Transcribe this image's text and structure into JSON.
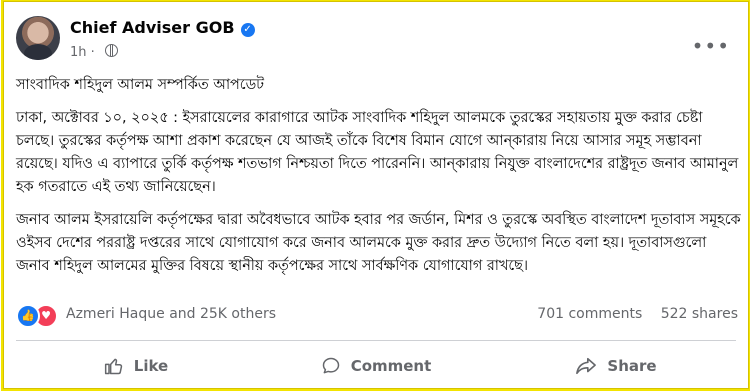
{
  "post": {
    "author": "Chief Adviser GOB",
    "time": "1h",
    "separator": "·",
    "title": "সাংবাদিক শহিদুল আলম সম্পর্কিত আপডেট",
    "paragraph1": "ঢাকা, অক্টোবর ১০, ২০২৫ : ইসরায়েলের কারাগারে আটক সাংবাদিক শহিদুল আলমকে তুরস্কের সহায়তায় মুক্ত করার চেষ্টা চলছে। তুরস্কের কর্তৃপক্ষ আশা প্রকাশ করেছেন যে আজই তাঁকে বিশেষ বিমান যোগে আন্কারায় নিয়ে আসার সমূহ সম্ভাবনা রয়েছে। যদিও এ ব্যাপারে তুর্কি কর্তৃপক্ষ শতভাগ নিশ্চয়তা দিতে পারেননি। আন্কারায় নিযুক্ত বাংলাদেশের রাষ্ট্রদূত জনাব আমানুল হক গতরাতে এই তথ্য জানিয়েছেন।",
    "paragraph2": "জনাব আলম ইসরায়েলি কর্তৃপক্ষের দ্বারা অবৈধভাবে আটক হবার পর জর্ডান, মিশর ও তুরস্কে অবস্থিত বাংলাদেশ দূতাবাস সমূহকে ওইসব দেশের পররাষ্ট্র দপ্তরের সাথে যোগাযোগ করে জনাব আলমকে মুক্ত করার দ্রুত উদ্যোগ নিতে বলা হয়। দূতাবাসগুলো জনাব শহিদুল আলমের মুক্তির বিষয়ে স্থানীয় কর্তৃপক্ষের সাথে সার্বক্ষণিক যোগাযোগ রাখছে।"
  },
  "stats": {
    "reactions_text": "Azmeri Haque and 25K others",
    "comments": "701 comments",
    "shares": "522 shares"
  },
  "actions": {
    "like": "Like",
    "comment": "Comment",
    "share": "Share"
  },
  "icons": {
    "verified": "verified-badge-icon",
    "globe": "globe-icon",
    "more": "more-options-icon",
    "like_reaction": "like-reaction-icon",
    "love_reaction": "love-reaction-icon"
  },
  "colors": {
    "accent": "#1877f2",
    "love": "#f33e58",
    "muted": "#65676b",
    "frame": "#f3e400"
  }
}
